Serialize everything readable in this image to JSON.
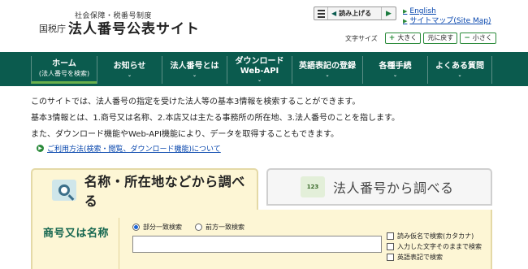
{
  "header": {
    "subtitle": "社会保障・税番号制度",
    "agency": "国税庁",
    "site_name": "法人番号公表サイト",
    "read_aloud_label": "読み上げる",
    "links": [
      "English",
      "サイトマップ(Site Map)"
    ],
    "font_size_label": "文字サイズ",
    "font_buttons": [
      {
        "symbol": "+",
        "label": "大きく"
      },
      {
        "symbol": "",
        "label": "元に戻す"
      },
      {
        "symbol": "−",
        "label": "小さく"
      }
    ]
  },
  "nav": {
    "items": [
      {
        "line1": "ホーム",
        "line2": "(法人番号を検索)"
      },
      {
        "line1": "お知らせ",
        "line2": ""
      },
      {
        "line1": "法人番号とは",
        "line2": ""
      },
      {
        "line1": "ダウンロード",
        "line2": "Web-API"
      },
      {
        "line1": "英語表記の登録",
        "line2": ""
      },
      {
        "line1": "各種手続",
        "line2": ""
      },
      {
        "line1": "よくある質問",
        "line2": ""
      }
    ],
    "chevron": "⌄"
  },
  "intro": {
    "line1": "このサイトでは、法人番号の指定を受けた法人等の基本3情報を検索することができます。",
    "line2": "基本3情報とは、1.商号又は名称、2.本店又は主たる事務所の所在地、3.法人番号のことを指します。",
    "line3": "また、ダウンロード機能やWeb-API機能により、データを取得することもできます。",
    "usage_link": "ご利用方法(検索・閲覧、ダウンロード機能)について"
  },
  "tabs": {
    "active": "名称・所在地などから調べる",
    "inactive": "法人番号から調べる",
    "inactive_icon_text": "123"
  },
  "form": {
    "field_label": "商号又は名称",
    "radio_options": [
      "部分一致検索",
      "前方一致検索"
    ],
    "selected_radio": "部分一致検索",
    "name_value": "",
    "checkboxes": [
      "読み仮名で検索(カタカナ)",
      "入力した文字そのままで検索",
      "英語表記で検索"
    ]
  }
}
